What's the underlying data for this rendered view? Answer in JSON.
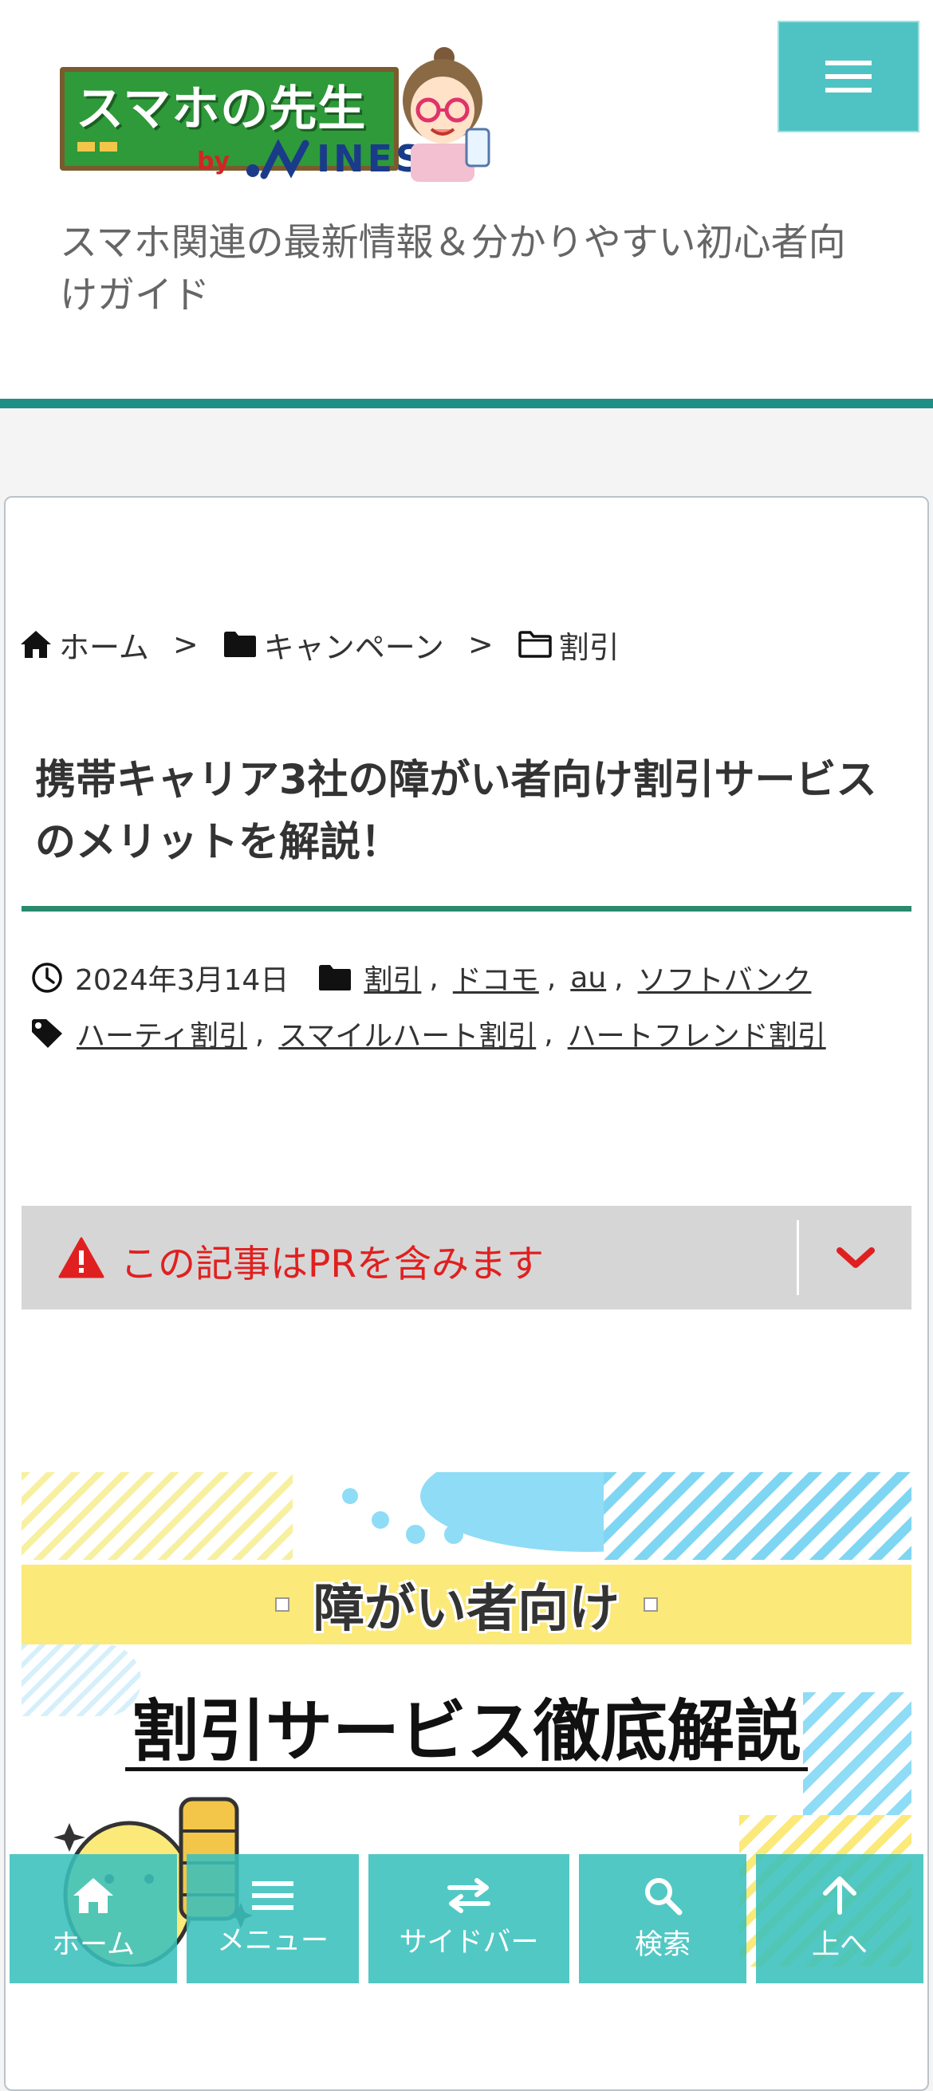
{
  "header": {
    "logo_main": "スマホの先生",
    "logo_by": "by",
    "logo_brand": "INEST",
    "tagline": "スマホ関連の最新情報＆分かりやすい初心者向けガイド"
  },
  "breadcrumb": {
    "home": "ホーム",
    "separator": ">",
    "category": "キャンペーン",
    "current": "割引"
  },
  "article": {
    "title": "携帯キャリア3社の障がい者向け割引サービスのメリットを解説！",
    "date": "2024年3月14日",
    "categories": [
      "割引",
      "ドコモ",
      "au",
      "ソフトバンク"
    ],
    "tags": [
      "ハーティ割引",
      "スマイルハート割引",
      "ハートフレンド割引"
    ],
    "comma": ","
  },
  "pr_notice": {
    "text": "この記事はPRを含みます"
  },
  "eyecatch": {
    "band_text": "障がい者向け",
    "headline": "割引サービス徹底解説"
  },
  "bottom_nav": {
    "home": "ホーム",
    "menu": "メニュー",
    "sidebar": "サイドバー",
    "search": "検索",
    "top": "上へ"
  },
  "colors": {
    "accent": "#1f8f86",
    "nav_bg": "#3ac0bc",
    "menu_button": "#4fc3c3",
    "pr_red": "#e02020",
    "pr_bg": "#d6d6d6"
  },
  "icons": {
    "menu": "hamburger-icon",
    "home": "home-icon",
    "folder": "folder-icon",
    "clock": "clock-icon",
    "tag": "tag-icon",
    "warning": "warning-icon",
    "chevron": "chevron-down-icon",
    "swap": "swap-icon",
    "search": "search-icon",
    "arrow_up": "arrow-up-icon"
  }
}
